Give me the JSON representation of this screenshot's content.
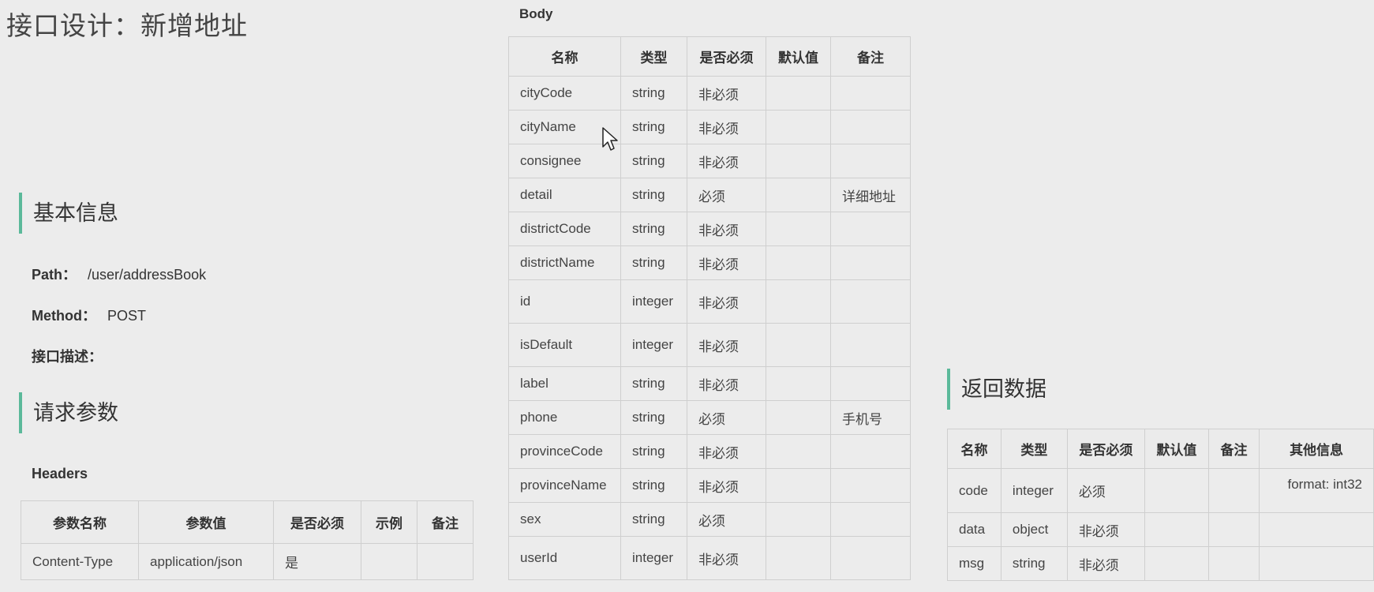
{
  "page_title": "接口设计：新增地址",
  "basic_info": {
    "heading": "基本信息",
    "path_label": "Path：",
    "path_value": "/user/addressBook",
    "method_label": "Method：",
    "method_value": "POST",
    "desc_label": "接口描述："
  },
  "request_params": {
    "heading": "请求参数",
    "headers_label": "Headers",
    "headers_table": {
      "columns": [
        "参数名称",
        "参数值",
        "是否必须",
        "示例",
        "备注"
      ],
      "rows": [
        [
          "Content-Type",
          "application/json",
          "是",
          "",
          ""
        ]
      ]
    }
  },
  "body": {
    "label": "Body",
    "columns": [
      "名称",
      "类型",
      "是否必须",
      "默认值",
      "备注"
    ],
    "rows": [
      [
        "cityCode",
        "string",
        "非必须",
        "",
        ""
      ],
      [
        "cityName",
        "string",
        "非必须",
        "",
        ""
      ],
      [
        "consignee",
        "string",
        "非必须",
        "",
        ""
      ],
      [
        "detail",
        "string",
        "必须",
        "",
        "详细地址"
      ],
      [
        "districtCode",
        "string",
        "非必须",
        "",
        ""
      ],
      [
        "districtName",
        "string",
        "非必须",
        "",
        ""
      ],
      [
        "id",
        "integer",
        "非必须",
        "",
        ""
      ],
      [
        "isDefault",
        "integer",
        "非必须",
        "",
        ""
      ],
      [
        "label",
        "string",
        "非必须",
        "",
        ""
      ],
      [
        "phone",
        "string",
        "必须",
        "",
        "手机号"
      ],
      [
        "provinceCode",
        "string",
        "非必须",
        "",
        ""
      ],
      [
        "provinceName",
        "string",
        "非必须",
        "",
        ""
      ],
      [
        "sex",
        "string",
        "必须",
        "",
        ""
      ],
      [
        "userId",
        "integer",
        "非必须",
        "",
        ""
      ]
    ]
  },
  "response": {
    "heading": "返回数据",
    "columns": [
      "名称",
      "类型",
      "是否必须",
      "默认值",
      "备注",
      "其他信息"
    ],
    "rows": [
      [
        "code",
        "integer",
        "必须",
        "",
        "",
        "format: int32"
      ],
      [
        "data",
        "object",
        "非必须",
        "",
        "",
        ""
      ],
      [
        "msg",
        "string",
        "非必须",
        "",
        "",
        ""
      ]
    ]
  }
}
